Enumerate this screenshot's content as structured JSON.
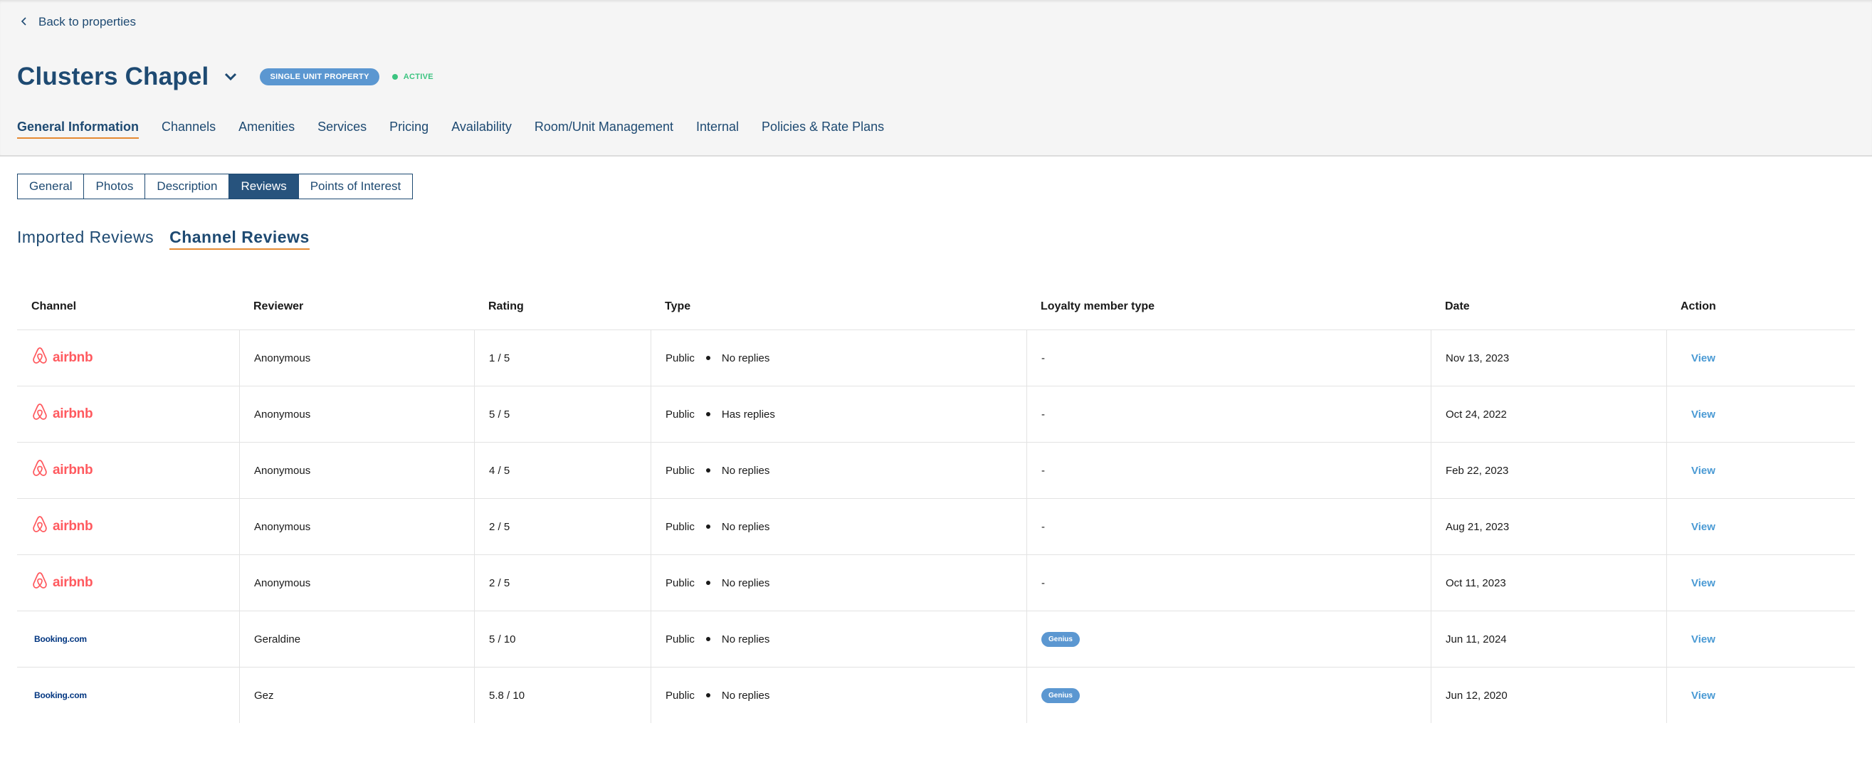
{
  "nav": {
    "back_label": "Back to properties"
  },
  "property": {
    "title": "Clusters Chapel",
    "type_badge": "SINGLE UNIT PROPERTY",
    "status": "ACTIVE"
  },
  "main_tabs": [
    {
      "label": "General Information",
      "active": true
    },
    {
      "label": "Channels"
    },
    {
      "label": "Amenities"
    },
    {
      "label": "Services"
    },
    {
      "label": "Pricing"
    },
    {
      "label": "Availability"
    },
    {
      "label": "Room/Unit Management"
    },
    {
      "label": "Internal"
    },
    {
      "label": "Policies & Rate Plans"
    }
  ],
  "sub_tabs": [
    {
      "label": "General"
    },
    {
      "label": "Photos"
    },
    {
      "label": "Description"
    },
    {
      "label": "Reviews",
      "active": true
    },
    {
      "label": "Points of Interest"
    }
  ],
  "review_tabs": [
    {
      "label": "Imported Reviews"
    },
    {
      "label": "Channel Reviews",
      "active": true
    }
  ],
  "table": {
    "headers": [
      "Channel",
      "Reviewer",
      "Rating",
      "Type",
      "Loyalty member type",
      "Date",
      "Action"
    ],
    "rows": [
      {
        "channel": "airbnb",
        "reviewer": "Anonymous",
        "rating": "1 / 5",
        "visibility": "Public",
        "replies": "No replies",
        "loyalty": "-",
        "date": "Nov 13, 2023",
        "action": "View"
      },
      {
        "channel": "airbnb",
        "reviewer": "Anonymous",
        "rating": "5 / 5",
        "visibility": "Public",
        "replies": "Has replies",
        "loyalty": "-",
        "date": "Oct 24, 2022",
        "action": "View"
      },
      {
        "channel": "airbnb",
        "reviewer": "Anonymous",
        "rating": "4 / 5",
        "visibility": "Public",
        "replies": "No replies",
        "loyalty": "-",
        "date": "Feb 22, 2023",
        "action": "View"
      },
      {
        "channel": "airbnb",
        "reviewer": "Anonymous",
        "rating": "2 / 5",
        "visibility": "Public",
        "replies": "No replies",
        "loyalty": "-",
        "date": "Aug 21, 2023",
        "action": "View"
      },
      {
        "channel": "airbnb",
        "reviewer": "Anonymous",
        "rating": "2 / 5",
        "visibility": "Public",
        "replies": "No replies",
        "loyalty": "-",
        "date": "Oct 11, 2023",
        "action": "View"
      },
      {
        "channel": "Booking.com",
        "reviewer": "Geraldine",
        "rating": "5 / 10",
        "visibility": "Public",
        "replies": "No replies",
        "loyalty": "Genius",
        "date": "Jun 11, 2024",
        "action": "View"
      },
      {
        "channel": "Booking.com",
        "reviewer": "Gez",
        "rating": "5.8 / 10",
        "visibility": "Public",
        "replies": "No replies",
        "loyalty": "Genius",
        "date": "Jun 12, 2020",
        "action": "View"
      }
    ]
  },
  "icons": {
    "back": "chevron-left-icon",
    "title_dropdown": "chevron-down-icon",
    "airbnb": "airbnb-logo-icon"
  },
  "colors": {
    "primary": "#1e4a72",
    "accent_underline": "#e58a32",
    "badge_blue": "#5b97d1",
    "active_green": "#3cc480",
    "airbnb_red": "#ff5a5f",
    "booking_blue": "#003580",
    "link_blue": "#4a9ad4"
  }
}
